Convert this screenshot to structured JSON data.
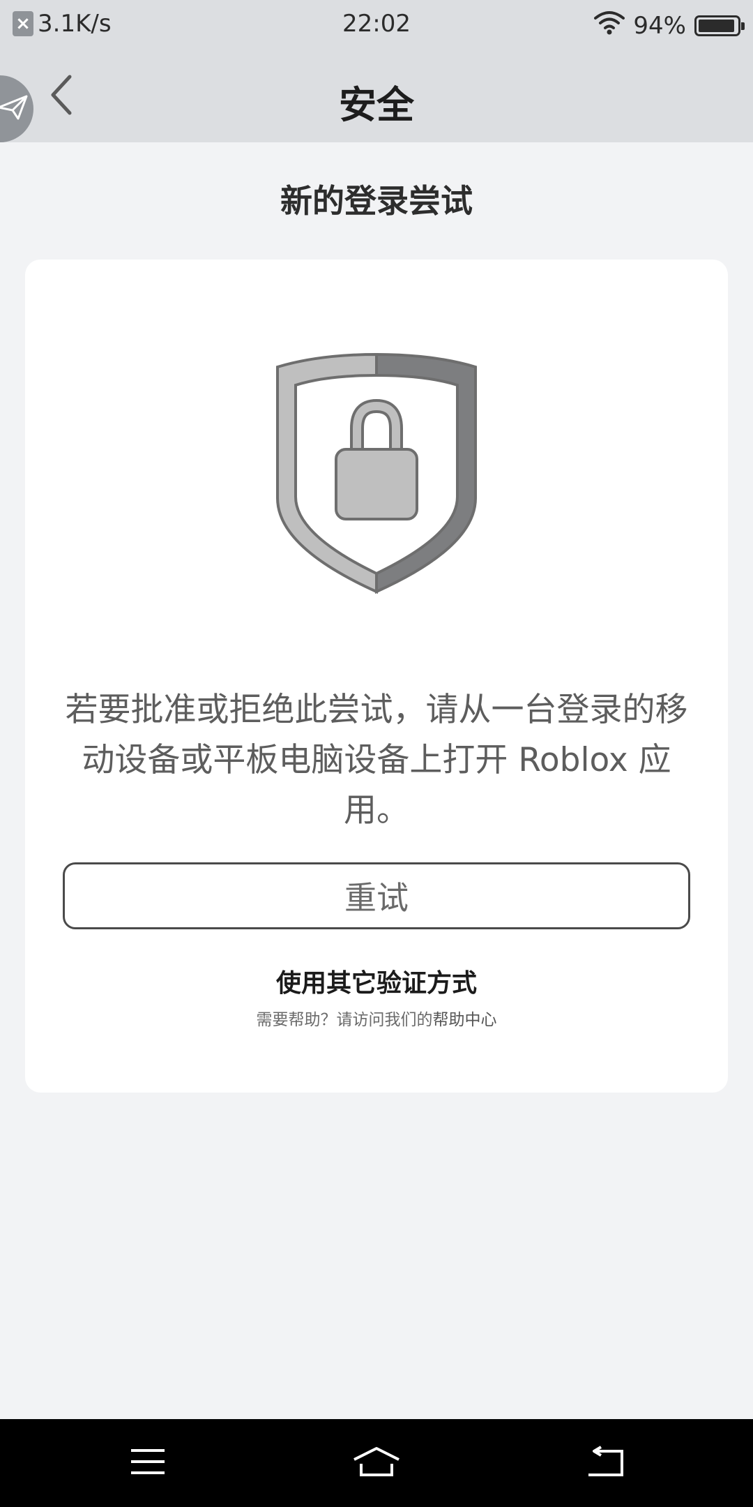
{
  "status_bar": {
    "net_speed": "3.1K/s",
    "time": "22:02",
    "battery": "94%",
    "battery_level": 0.94,
    "icons": [
      "close-notification-icon",
      "wifi-icon",
      "battery-icon"
    ]
  },
  "header": {
    "title": "安全",
    "back_icon": "chevron-left-icon",
    "float_icon": "paper-plane-icon"
  },
  "page": {
    "title": "新的登录尝试"
  },
  "card": {
    "icon": "shield-lock-icon",
    "message": "若要批准或拒绝此尝试，请从一台登录的移动设备或平板电脑设备上打开 Roblox 应用。",
    "retry_label": "重试",
    "alt_method_label": "使用其它验证方式",
    "help_prefix": "需要帮助？请访问我们的",
    "help_link": "帮助中心"
  },
  "nav_bar": {
    "icons": [
      "menu-icon",
      "home-icon",
      "back-icon"
    ]
  },
  "colors": {
    "bar_bg": "#dcdee1",
    "page_bg": "#f2f3f5",
    "card_bg": "#ffffff",
    "shield_dark": "#7d7e80",
    "shield_light": "#bfbfbf"
  }
}
